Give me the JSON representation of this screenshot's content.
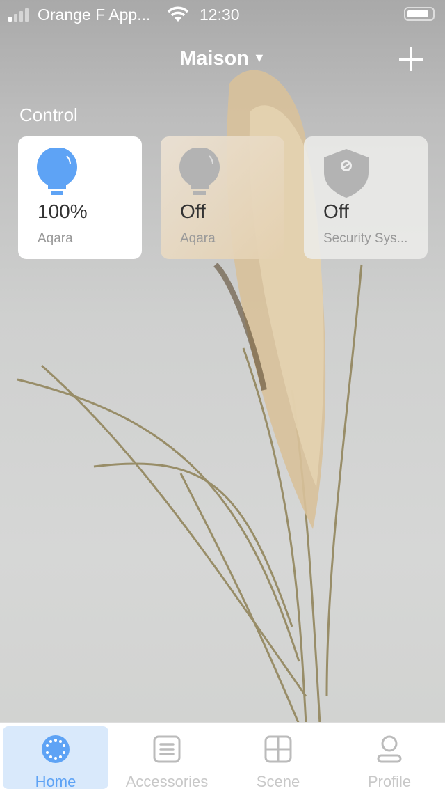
{
  "status_bar": {
    "carrier": "Orange F App...",
    "time": "12:30",
    "signal_bars": 1,
    "battery_level": 0.8
  },
  "header": {
    "title": "Maison",
    "dropdown_icon": "caret-down-icon",
    "add_icon": "plus-icon"
  },
  "section_title": "Control",
  "tiles": [
    {
      "value": "100%",
      "name": "Aqara",
      "icon": "bulb-icon",
      "state": "on",
      "color": "#5ea3f5"
    },
    {
      "value": "Off",
      "name": "Aqara",
      "icon": "bulb-icon",
      "state": "off"
    },
    {
      "value": "Off",
      "name": "Security Sys...",
      "icon": "shield-icon",
      "state": "off"
    }
  ],
  "tabs": [
    {
      "label": "Home",
      "icon": "home-icon",
      "active": true
    },
    {
      "label": "Accessories",
      "icon": "accessories-icon"
    },
    {
      "label": "Scene",
      "icon": "scene-icon"
    },
    {
      "label": "Profile",
      "icon": "profile-icon"
    }
  ],
  "colors": {
    "accent": "#5ea3f5",
    "inactive": "#b3b3b3"
  }
}
